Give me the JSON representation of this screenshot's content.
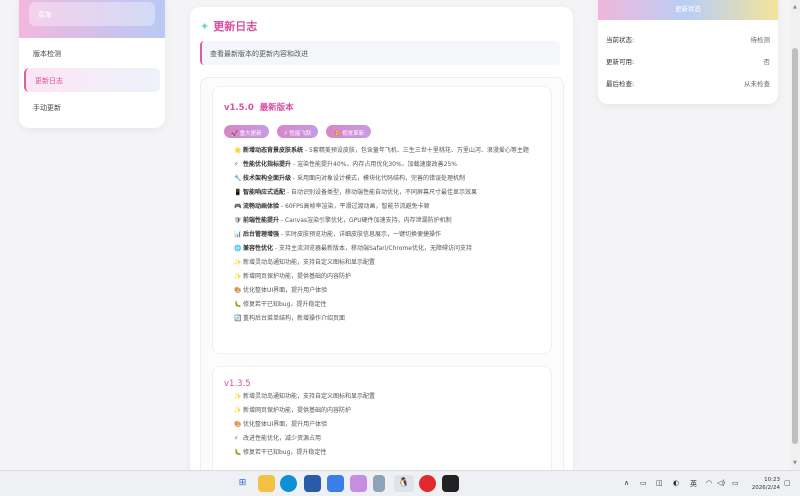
{
  "sidebar": {
    "header_label": "菜单",
    "items": [
      {
        "label": "版本检测",
        "active": false
      },
      {
        "label": "更新日志",
        "active": true
      },
      {
        "label": "手动更新",
        "active": false
      }
    ]
  },
  "main": {
    "title": "更新日志",
    "intro": "查看最新版本的更新内容和改进",
    "releases": [
      {
        "version": "v1.5.0",
        "badge": "最新版本",
        "tags": [
          "重大更新",
          "性能飞跃",
          "视觉革新"
        ],
        "items": [
          {
            "icon": "🌟",
            "bold": "新增动态背景皮肤系统",
            "text": " - 5套精美预设皮肤，包含童年飞机、三生三世十里桃花、万里山河、浪漫爱心等主题"
          },
          {
            "icon": "⚡",
            "bold": "性能优化指标提升",
            "text": " - 渲染性能提升40%，内存占用优化30%，加载速度改善25%"
          },
          {
            "icon": "🔧",
            "bold": "技术架构全面升级",
            "text": " - 采用面向对象设计模式，模块化代码结构，完善的错误处理机制"
          },
          {
            "icon": "📱",
            "bold": "智能响应式适配",
            "text": " - 自动识别设备类型，移动端性能自动优化，不同屏幕尺寸最佳显示效果"
          },
          {
            "icon": "🎮",
            "bold": "流畅动画体验",
            "text": " - 60FPS高帧率渲染，平滑过渡动画，智能节流避免卡顿"
          },
          {
            "icon": "🛡",
            "bold": "前端性能提升",
            "text": " - Canvas渲染引擎优化，GPU硬件加速支持，内存泄漏防护机制"
          },
          {
            "icon": "📊",
            "bold": "后台管理增强",
            "text": " - 实时皮肤预览功能，详细皮肤信息展示，一键切换便捷操作"
          },
          {
            "icon": "🌐",
            "bold": "兼容性优化",
            "text": " - 支持主流浏览器最新版本，移动端Safari/Chrome优化，无障碍访问支持"
          },
          {
            "icon": "✨",
            "bold": "",
            "text": "新增灵动岛通知功能，支持自定义图标和显示配置"
          },
          {
            "icon": "✨",
            "bold": "",
            "text": "新增网页保护功能，提供基础的内容防护"
          },
          {
            "icon": "🎨",
            "bold": "",
            "text": "优化整体UI界面，提升用户体验"
          },
          {
            "icon": "🐛",
            "bold": "",
            "text": "修复若干已知bug，提升稳定性"
          },
          {
            "icon": "🔄",
            "bold": "",
            "text": "重构后台菜单结构，新增操作介绍页面"
          }
        ]
      },
      {
        "version": "v1.3.5",
        "items": [
          {
            "icon": "✨",
            "text": "新增灵动岛通知功能，支持自定义图标和显示配置"
          },
          {
            "icon": "✨",
            "text": "新增网页保护功能，提供基础的内容防护"
          },
          {
            "icon": "🎨",
            "text": "优化整体UI界面，提升用户体验"
          },
          {
            "icon": "⚡",
            "text": "改进性能优化，减少资源占用"
          },
          {
            "icon": "🐛",
            "text": "修复若干已知bug，提升稳定性"
          }
        ]
      }
    ]
  },
  "status_panel": {
    "title": "更新状态",
    "rows": [
      {
        "label": "当前状态:",
        "value": "待检测"
      },
      {
        "label": "更新可用:",
        "value": "否"
      },
      {
        "label": "最后检查:",
        "value": "从未检查"
      }
    ]
  },
  "taskbar": {
    "ime": "英",
    "time": "10:23",
    "date": "2026/2/24"
  }
}
